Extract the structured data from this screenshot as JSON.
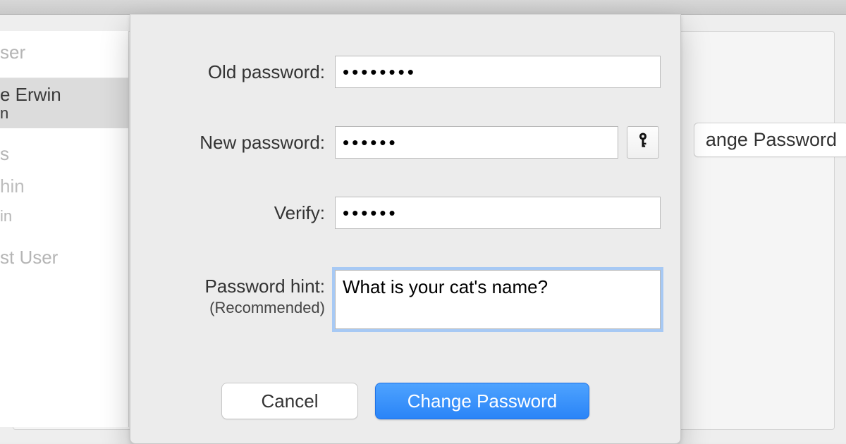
{
  "background": {
    "sidebar_header": "ser",
    "selected_user": "e Erwin",
    "selected_user_sub": "n",
    "items": [
      "s",
      "hin",
      "in",
      "st User"
    ],
    "change_button": "ange Password"
  },
  "sheet": {
    "old_password": {
      "label": "Old password:",
      "value": "••••••••"
    },
    "new_password": {
      "label": "New password:",
      "value": "••••••"
    },
    "verify": {
      "label": "Verify:",
      "value": "••••••"
    },
    "hint": {
      "label": "Password hint:",
      "sublabel": "(Recommended)",
      "value": "What is your cat's name?"
    },
    "buttons": {
      "cancel": "Cancel",
      "submit": "Change Password"
    }
  }
}
